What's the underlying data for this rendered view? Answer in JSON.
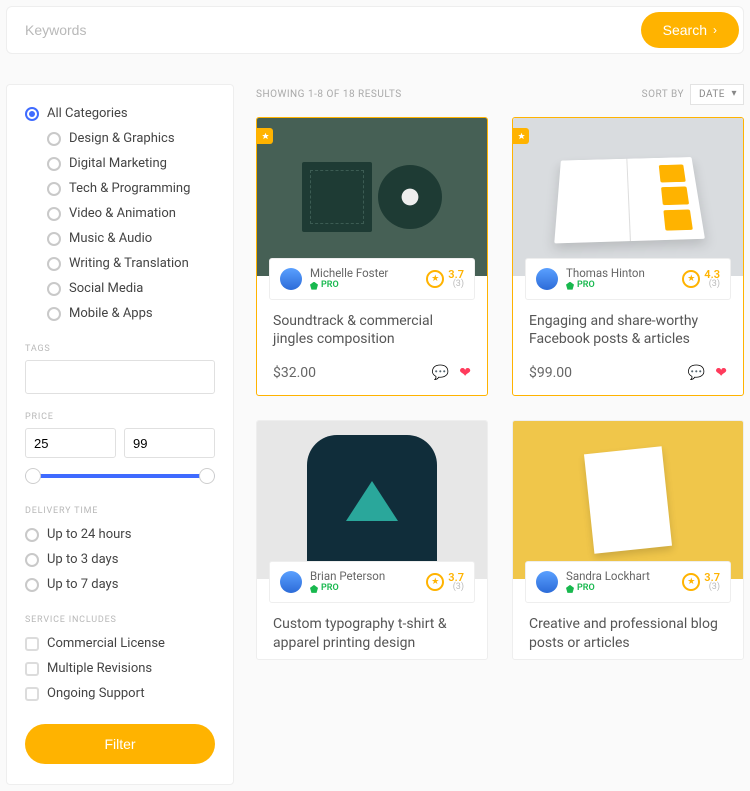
{
  "search": {
    "placeholder": "Keywords",
    "button": "Search"
  },
  "sidebar": {
    "all_label": "All Categories",
    "cats": [
      "Design & Graphics",
      "Digital Marketing",
      "Tech & Programming",
      "Video & Animation",
      "Music & Audio",
      "Writing & Translation",
      "Social Media",
      "Mobile & Apps"
    ],
    "tags_label": "TAGS",
    "price_label": "PRICE",
    "price_min": "25",
    "price_max": "99",
    "delivery_label": "DELIVERY TIME",
    "delivery": [
      "Up to 24 hours",
      "Up to 3 days",
      "Up to 7 days"
    ],
    "includes_label": "SERVICE INCLUDES",
    "includes": [
      "Commercial License",
      "Multiple Revisions",
      "Ongoing Support"
    ],
    "filter_btn": "Filter"
  },
  "results": {
    "count_text": "SHOWING 1-8 OF 18 RESULTS",
    "sort_label": "SORT BY",
    "sort_value": "DATE"
  },
  "cards": [
    {
      "featured": true,
      "seller": "Michelle Foster",
      "pro": "PRO",
      "rating": "3.7",
      "rcount": "(3)",
      "title": "Soundtrack & commercial jingles composition",
      "price": "$32.00"
    },
    {
      "featured": true,
      "seller": "Thomas Hinton",
      "pro": "PRO",
      "rating": "4.3",
      "rcount": "(3)",
      "title": "Engaging and share-worthy Facebook posts & articles",
      "price": "$99.00"
    },
    {
      "featured": false,
      "seller": "Brian Peterson",
      "pro": "PRO",
      "rating": "3.7",
      "rcount": "(3)",
      "title": "Custom typography t-shirt & apparel printing design",
      "price": ""
    },
    {
      "featured": false,
      "seller": "Sandra Lockhart",
      "pro": "PRO",
      "rating": "3.7",
      "rcount": "(3)",
      "title": "Creative and professional blog posts or articles",
      "price": ""
    }
  ]
}
